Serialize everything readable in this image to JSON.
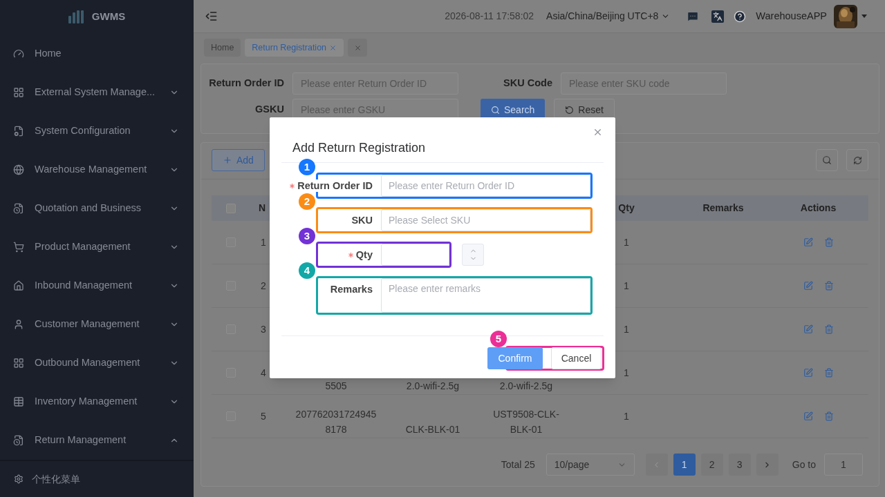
{
  "sidebar": {
    "logo": "GWMS",
    "items": [
      {
        "label": "Home",
        "kind": "link"
      },
      {
        "label": "External System Manage...",
        "kind": "group",
        "expanded": false
      },
      {
        "label": "System Configuration",
        "kind": "group",
        "expanded": false
      },
      {
        "label": "Warehouse Management",
        "kind": "group",
        "expanded": false
      },
      {
        "label": "Quotation and Business",
        "kind": "group",
        "expanded": false
      },
      {
        "label": "Product Management",
        "kind": "group",
        "expanded": false
      },
      {
        "label": "Inbound Management",
        "kind": "group",
        "expanded": false
      },
      {
        "label": "Customer Management",
        "kind": "group",
        "expanded": false
      },
      {
        "label": "Outbound Management",
        "kind": "group",
        "expanded": false
      },
      {
        "label": "Inventory Management",
        "kind": "group",
        "expanded": false
      },
      {
        "label": "Return Management",
        "kind": "group",
        "expanded": true
      }
    ],
    "footer": "个性化菜单"
  },
  "header": {
    "datetime": "2026-08-11 17:58:02",
    "timezone": "Asia/China/Beijing UTC+8",
    "user": "WarehouseAPP"
  },
  "tabs": [
    {
      "label": "Home",
      "selected": false,
      "closable": false
    },
    {
      "label": "Return Registration",
      "selected": true,
      "closable": true
    }
  ],
  "search_form": {
    "fields": [
      {
        "label": "Return Order ID",
        "placeholder": "Please enter Return Order ID"
      },
      {
        "label": "SKU Code",
        "placeholder": "Please enter SKU code"
      },
      {
        "label": "GSKU",
        "placeholder": "Please enter GSKU"
      }
    ],
    "buttons": [
      {
        "label": "Search",
        "kind": "primary"
      },
      {
        "label": "Reset",
        "kind": "default"
      }
    ]
  },
  "toolbar": {
    "add": "Add"
  },
  "table": {
    "all_checked": false,
    "columns": [
      "N",
      "Qty",
      "Remarks",
      "Actions"
    ],
    "rows": [
      {
        "checked": false,
        "no": "1",
        "qty": "1"
      },
      {
        "checked": false,
        "no": "2",
        "qty": "1"
      },
      {
        "checked": false,
        "no": "3",
        "qty": "1"
      },
      {
        "checked": false,
        "no": "4",
        "column_3": "5505",
        "column_4": "2.0-wifi-2.5g",
        "column_5": "2.0-wifi-2.5g",
        "qty": "1"
      },
      {
        "checked": false,
        "no": "5",
        "column_3": "2077620317249458178",
        "column_4": "CLK-BLK-01",
        "column_5": "UST9508-CLK-BLK-01",
        "qty": "1"
      }
    ]
  },
  "pagination": {
    "total": "Total 25",
    "page_size": "10/page",
    "pages": [
      {
        "label": "1",
        "selected": true
      },
      {
        "label": "2",
        "selected": false
      },
      {
        "label": "3",
        "selected": false
      }
    ],
    "goto_label": "Go to",
    "goto_value": "1"
  },
  "dialog": {
    "title": "Add Return Registration",
    "fields": [
      {
        "label": "Return Order ID",
        "required": true,
        "kind": "text",
        "placeholder": "Please enter Return Order ID",
        "annotation": {
          "number": "1",
          "color": "#1677ff"
        }
      },
      {
        "label": "SKU",
        "required": false,
        "kind": "select",
        "placeholder": "Please Select SKU",
        "annotation": {
          "number": "2",
          "color": "#fa8c16"
        }
      },
      {
        "label": "Qty",
        "required": true,
        "kind": "number",
        "annotation": {
          "number": "3",
          "color": "#7232d6"
        }
      },
      {
        "label": "Remarks",
        "required": false,
        "kind": "textarea",
        "placeholder": "Please enter remarks",
        "annotation": {
          "number": "4",
          "color": "#13a8a8"
        }
      }
    ],
    "buttons": [
      {
        "label": "Confirm",
        "kind": "primary"
      },
      {
        "label": "Cancel",
        "kind": "default"
      }
    ],
    "buttons_annotation": {
      "number": "5",
      "color": "#eb2f96"
    }
  }
}
